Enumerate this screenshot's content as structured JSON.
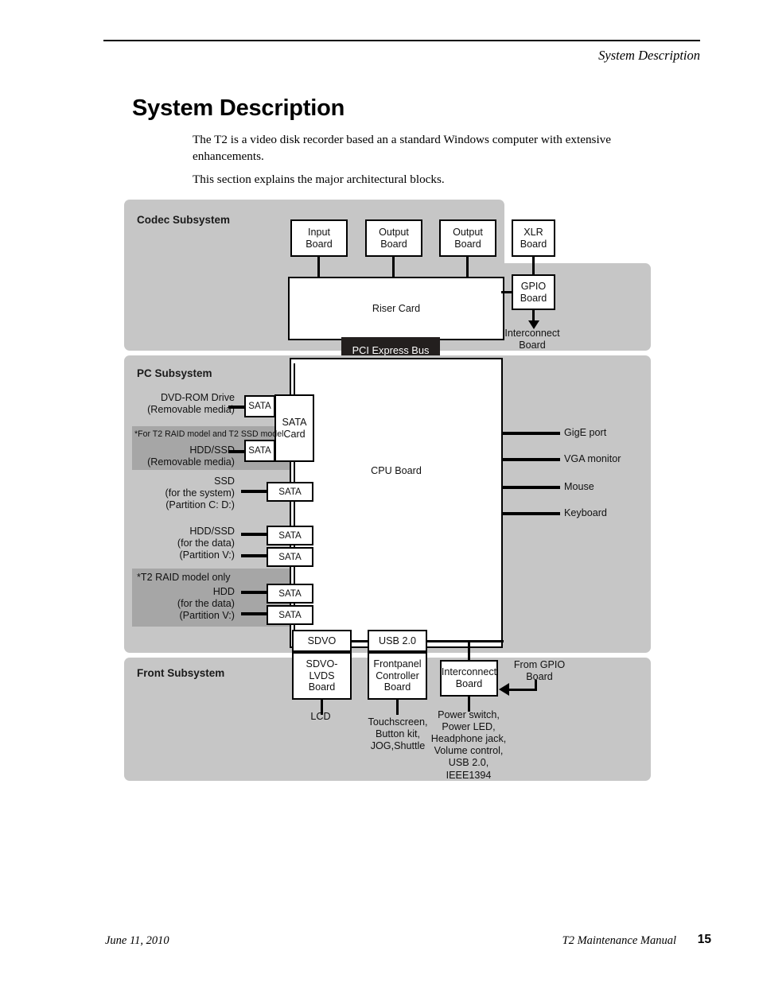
{
  "header": {
    "running_head": "System Description"
  },
  "content": {
    "title": "System Description",
    "paragraph1": "The T2 is a video disk recorder based an a standard Windows computer with extensive enhancements.",
    "paragraph2": "This section explains the major architectural blocks."
  },
  "diagram": {
    "codec": {
      "label": "Codec Subsystem",
      "input_board": "Input\nBoard",
      "output_board_1": "Output\nBoard",
      "output_board_2": "Output\nBoard",
      "xlr_board": "XLR\nBoard",
      "gpio_board": "GPIO\nBoard",
      "riser_card": "Riser Card",
      "interconnect_board": "Interconnect\nBoard",
      "pci_express_bus": "PCI Express Bus"
    },
    "pc": {
      "label": "PC Subsystem",
      "cpu_board": "CPU Board",
      "sata_card": "SATA\nCard",
      "sata_port": "SATA",
      "note_ssd_model": "*For T2 RAID model and T2 SSD model",
      "note_raid_only": "*T2 RAID model only",
      "drives": [
        {
          "name": "DVD-ROM Drive",
          "detail": "(Removable media)"
        },
        {
          "name": "HDD/SSD",
          "detail": "(Removable media)"
        },
        {
          "name": "SSD",
          "detail": "(for the system)\n(Partition C: D:)"
        },
        {
          "name": "HDD/SSD",
          "detail": "(for the data)\n(Partition V:)"
        },
        {
          "name": "HDD",
          "detail": "(for the data)\n(Partition V:)"
        }
      ],
      "ports": [
        "GigE port",
        "VGA monitor",
        "Mouse",
        "Keyboard"
      ]
    },
    "front": {
      "label": "Front Subsystem",
      "sdvo_bus": "SDVO",
      "usb_bus": "USB 2.0",
      "sdvo_lvds_board": "SDVO-LVDS\nBoard",
      "frontpanel_controller_board": "Frontpanel\nController\nBoard",
      "interconnect_board": "Interconnect\nBoard",
      "from_gpio_board": "From GPIO\nBoard",
      "lcd": "LCD",
      "frontpanel_devices": "Touchscreen,\nButton kit,\nJOG,Shuttle",
      "interconnect_devices": "Power switch,\nPower LED,\nHeadphone jack,\nVolume control,\nUSB 2.0,\nIEEE1394"
    }
  },
  "footer": {
    "date": "June 11, 2010",
    "manual": "T2 Maintenance Manual",
    "page_number": "15"
  }
}
